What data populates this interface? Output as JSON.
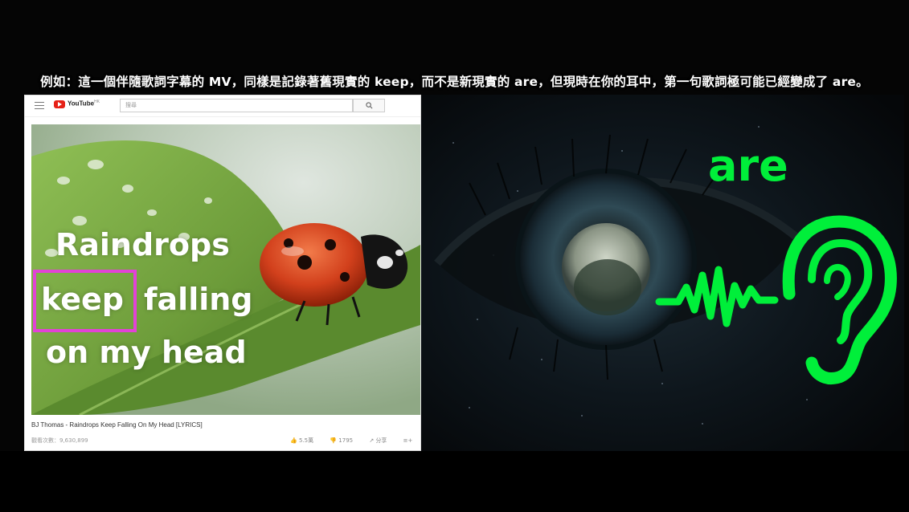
{
  "caption": "例如：這一個伴隨歌詞字幕的 MV，同樣是記錄著舊現實的 keep，而不是新現實的 are，但現時在你的耳中，第一句歌詞極可能已經變成了 are。",
  "youtube": {
    "brand": "YouTube",
    "brand_sup": "HK",
    "search_placeholder": "搜尋",
    "video_title": "BJ Thomas - Raindrops Keep Falling On My Head [LYRICS]",
    "views": "觀看次數：9,630,899",
    "actions": [
      "5.5萬",
      "1795",
      "分享",
      "",
      "..."
    ]
  },
  "lyrics": {
    "line1": "Raindrops",
    "line2_word": "keep",
    "line2_rest": "falling",
    "line3": "on my head"
  },
  "right_panel": {
    "word": "are"
  },
  "colors": {
    "highlight_box": "#e242d6",
    "ear_green": "#00ef3a"
  },
  "icons": [
    "menu-icon",
    "youtube-logo-icon",
    "search-icon",
    "like-icon",
    "dislike-icon",
    "share-icon",
    "save-icon",
    "more-icon",
    "ear-icon",
    "soundwave-icon",
    "eye-image"
  ]
}
